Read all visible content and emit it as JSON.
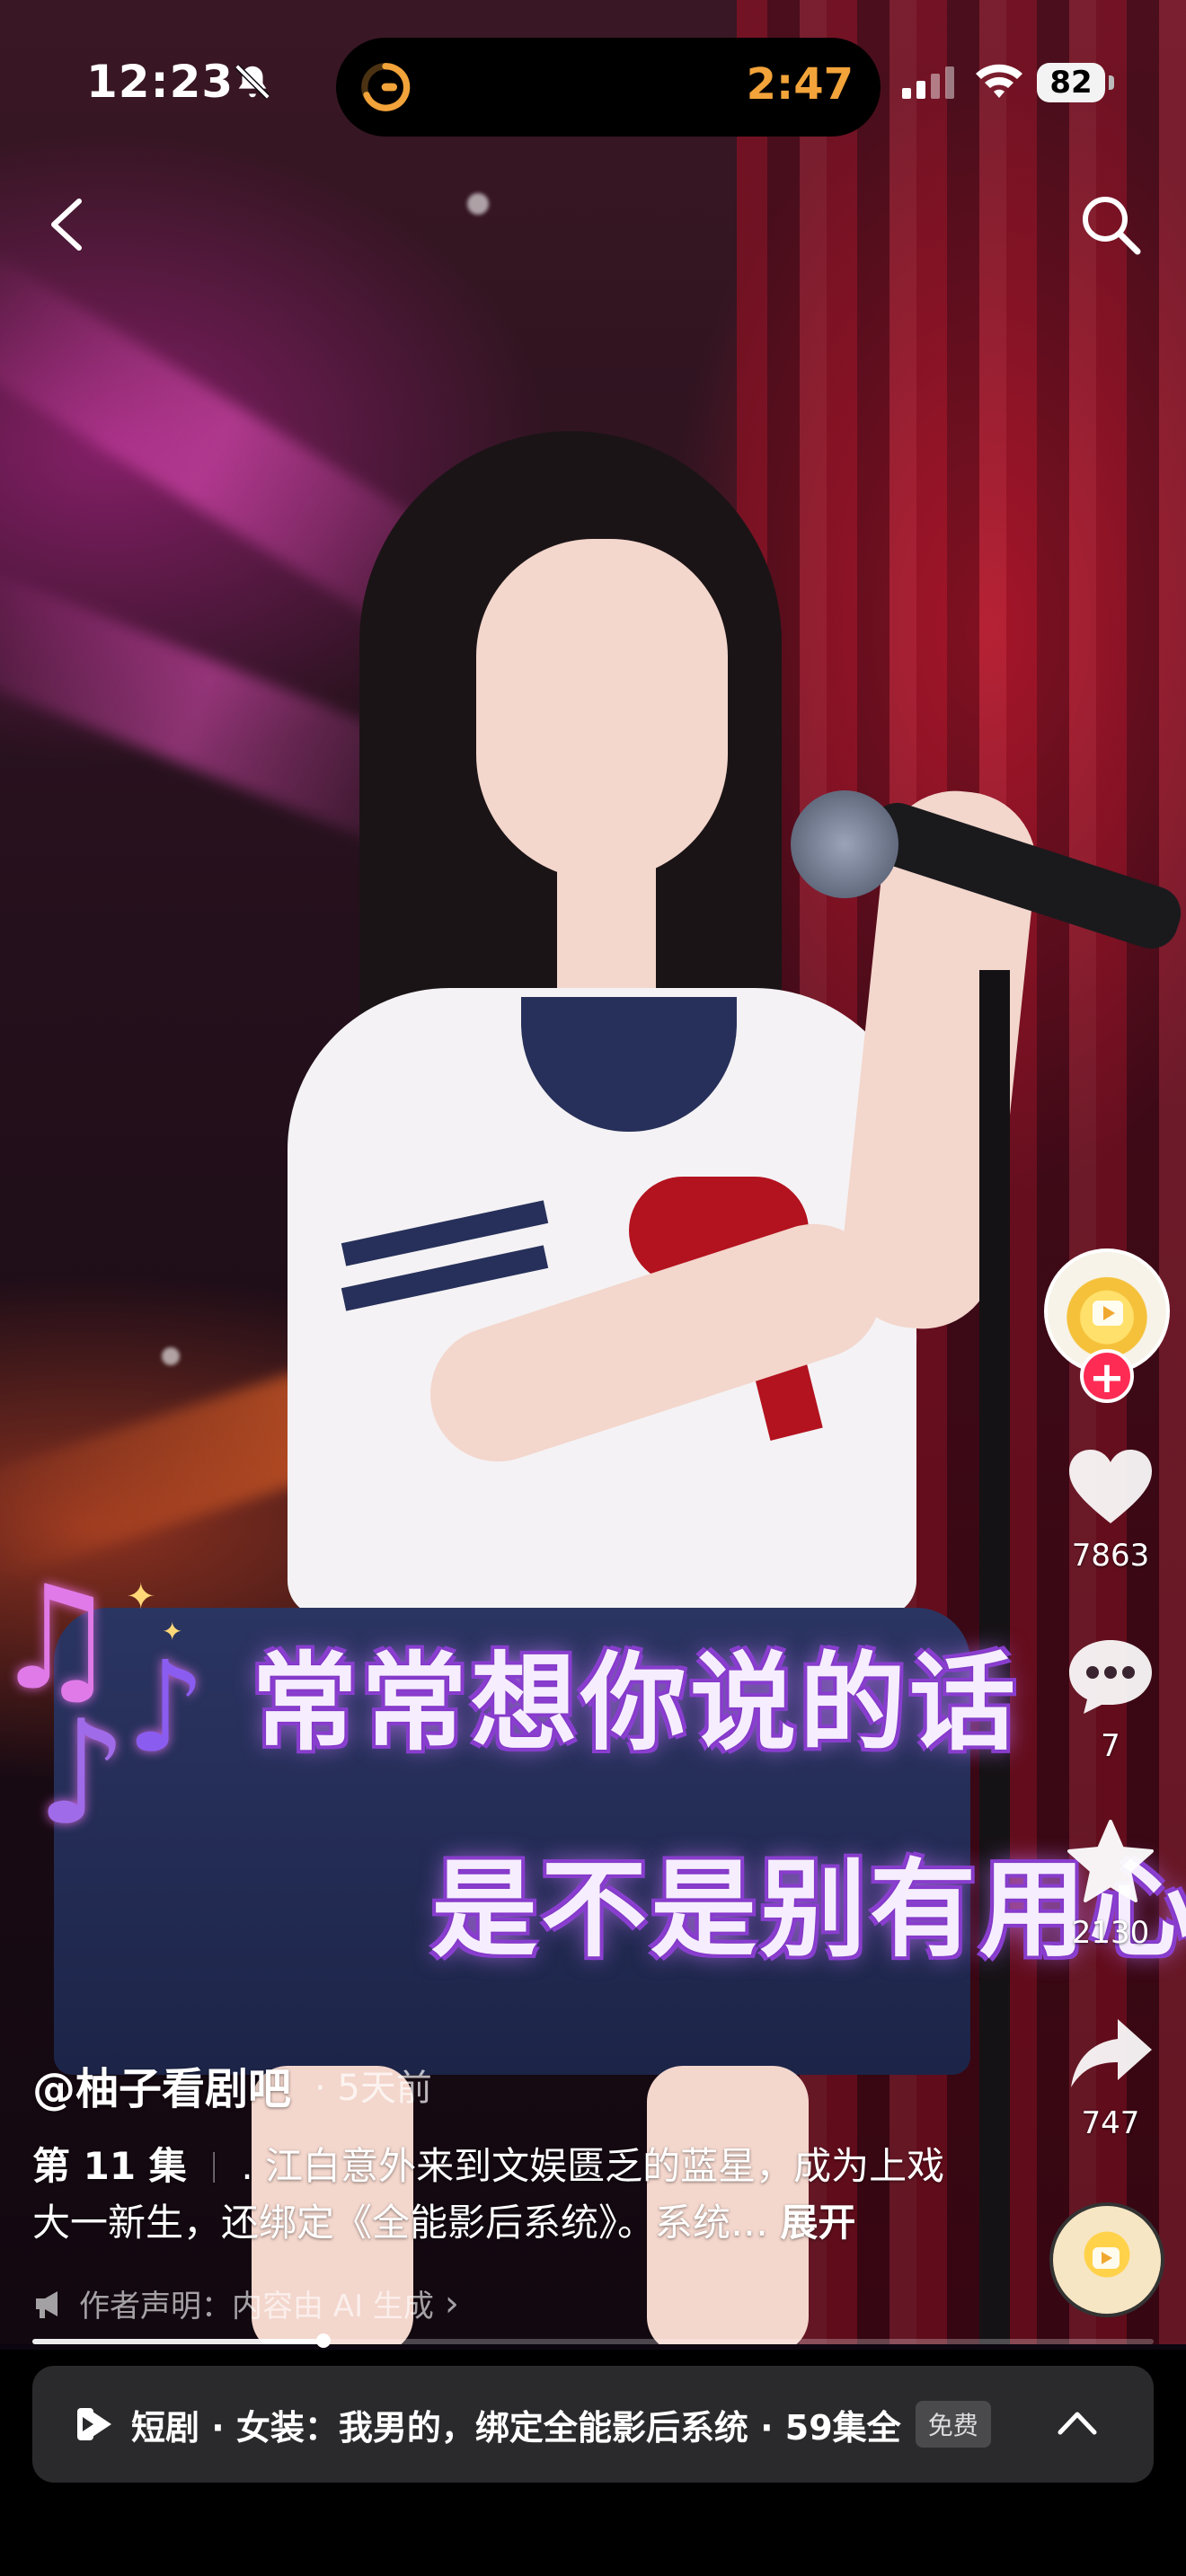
{
  "status_bar": {
    "time": "12:23",
    "timer": "2:47",
    "battery": "82",
    "icons": [
      "bell-slash-icon",
      "timer-icon",
      "cellular-signal-icon",
      "wifi-icon",
      "battery-icon"
    ]
  },
  "top_nav": {
    "icons": [
      "back-chevron-icon",
      "search-icon"
    ]
  },
  "subtitles": {
    "line1": "常常想你说的话",
    "line2": "是不是别有用心"
  },
  "right_rail": {
    "likes": "7863",
    "comments": "7",
    "favorites": "2130",
    "shares": "747",
    "icons": [
      "avatar",
      "follow-plus-icon",
      "heart-icon",
      "comment-icon",
      "star-icon",
      "share-icon",
      "music-disc-icon"
    ]
  },
  "caption": {
    "author": "@柚子看剧吧",
    "posted": "· 5天前",
    "episode": "第 11 集",
    "separator": "｜",
    "text_line1": ". 江白意外来到文娱匮乏的蓝星，成为上戏",
    "text_line2": "大一新生，还绑定《全能影后系统》。系统…",
    "expand": "展开",
    "declaration": "作者声明：内容由 AI 生成",
    "declaration_chevron": "›"
  },
  "progress": {
    "fraction": 0.26
  },
  "drama_bar": {
    "text": "短剧 · 女装：我男的，绑定全能影后系统 · 59集全",
    "badge": "免费"
  },
  "colors": {
    "accent_pink": "#fe2c55",
    "timer_orange": "#f2a33a",
    "subtitle_purple": "#8a3fd0"
  }
}
